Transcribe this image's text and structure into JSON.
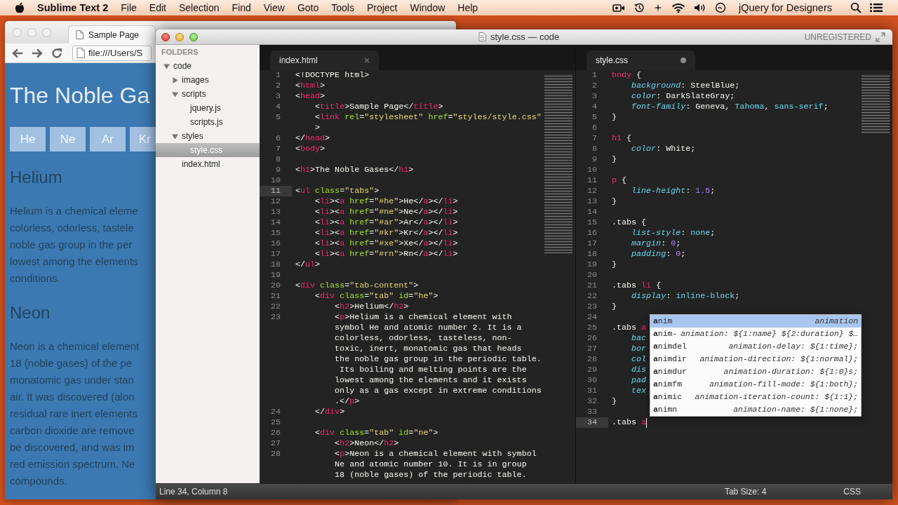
{
  "menubar": {
    "app": "Sublime Text 2",
    "menus": [
      "File",
      "Edit",
      "Selection",
      "Find",
      "View",
      "Goto",
      "Tools",
      "Project",
      "Window",
      "Help"
    ],
    "account": "jQuery for Designers"
  },
  "browser": {
    "tabs": [
      {
        "label": "Sample Page",
        "selected": true
      }
    ],
    "address": "file:///Users/S",
    "page": {
      "heading": "The Noble Ga",
      "tabs": [
        "He",
        "Ne",
        "Ar",
        "Kr"
      ],
      "sections": [
        {
          "heading": "Helium",
          "lines": [
            "Helium is a chemical eleme",
            "colorless, odorless, tastele",
            "noble gas group in the per",
            "lowest among the elements",
            "conditions."
          ]
        },
        {
          "heading": "Neon",
          "lines": [
            "Neon is a chemical element",
            "18 (noble gases) of the pe",
            "monatomic gas under stan",
            "air. It was discovered (alon",
            "residual rare inert elements",
            "carbon dioxide are remove",
            "be discovered, and was im",
            "red emission spectrum. Ne",
            "compounds."
          ]
        }
      ]
    }
  },
  "editor": {
    "title": "style.css — code",
    "registration": "UNREGISTERED",
    "sidebar": {
      "header": "FOLDERS",
      "items": [
        {
          "label": "code",
          "kind": "folder",
          "expanded": true,
          "selected": false,
          "children": [
            {
              "label": "images",
              "kind": "folder",
              "expanded": false,
              "selected": false
            },
            {
              "label": "scripts",
              "kind": "folder",
              "expanded": true,
              "selected": false,
              "children": [
                {
                  "label": "jquery.js",
                  "kind": "file",
                  "selected": false
                },
                {
                  "label": "scripts.js",
                  "kind": "file",
                  "selected": false
                }
              ]
            },
            {
              "label": "styles",
              "kind": "folder",
              "expanded": true,
              "selected": false,
              "children": [
                {
                  "label": "style.css",
                  "kind": "file",
                  "selected": true
                }
              ]
            },
            {
              "label": "index.html",
              "kind": "file",
              "selected": false
            }
          ]
        }
      ]
    },
    "groups": [
      {
        "focused": false,
        "tab": {
          "label": "index.html",
          "dirty": false
        },
        "rows": [
          {
            "n": "1",
            "current": false,
            "tokens": [
              {
                "kind": "pl",
                "text": "<!DOCTYPE html>"
              }
            ]
          },
          {
            "n": "2",
            "current": false,
            "tokens": [
              {
                "kind": "pl",
                "text": "<"
              },
              {
                "kind": "tag",
                "text": "html"
              },
              {
                "kind": "pl",
                "text": ">"
              }
            ]
          },
          {
            "n": "3",
            "current": false,
            "tokens": [
              {
                "kind": "pl",
                "text": "<"
              },
              {
                "kind": "tag",
                "text": "head"
              },
              {
                "kind": "pl",
                "text": ">"
              }
            ]
          },
          {
            "n": "4",
            "current": false,
            "tokens": [
              {
                "kind": "pl",
                "text": "    <"
              },
              {
                "kind": "tag",
                "text": "title"
              },
              {
                "kind": "pl",
                "text": ">Sample Page</"
              },
              {
                "kind": "tag",
                "text": "title"
              },
              {
                "kind": "pl",
                "text": ">"
              }
            ]
          },
          {
            "n": "5",
            "current": false,
            "tokens": [
              {
                "kind": "pl",
                "text": "    <"
              },
              {
                "kind": "tag",
                "text": "link"
              },
              {
                "kind": "attr",
                "text": " rel"
              },
              {
                "kind": "pl",
                "text": "="
              },
              {
                "kind": "str",
                "text": "\"stylesheet\""
              },
              {
                "kind": "attr",
                "text": " href"
              },
              {
                "kind": "pl",
                "text": "="
              },
              {
                "kind": "str",
                "text": "\"styles/style.css\""
              }
            ]
          },
          {
            "current": false,
            "tokens": [
              {
                "kind": "pl",
                "text": "    >"
              }
            ]
          },
          {
            "n": "6",
            "current": false,
            "tokens": [
              {
                "kind": "pl",
                "text": "</"
              },
              {
                "kind": "tag",
                "text": "head"
              },
              {
                "kind": "pl",
                "text": ">"
              }
            ]
          },
          {
            "n": "7",
            "current": false,
            "tokens": [
              {
                "kind": "pl",
                "text": "<"
              },
              {
                "kind": "tag",
                "text": "body"
              },
              {
                "kind": "pl",
                "text": ">"
              }
            ]
          },
          {
            "n": "8",
            "current": false
          },
          {
            "n": "9",
            "current": false,
            "tokens": [
              {
                "kind": "pl",
                "text": "<"
              },
              {
                "kind": "tag",
                "text": "h1"
              },
              {
                "kind": "pl",
                "text": ">The Noble Gases</"
              },
              {
                "kind": "tag",
                "text": "h1"
              },
              {
                "kind": "pl",
                "text": ">"
              }
            ]
          },
          {
            "n": "10",
            "current": false
          },
          {
            "n": "11",
            "current": true,
            "tokens": [
              {
                "kind": "pl",
                "text": "<"
              },
              {
                "kind": "tag",
                "text": "ul"
              },
              {
                "kind": "attr",
                "text": " class"
              },
              {
                "kind": "pl",
                "text": "="
              },
              {
                "kind": "str",
                "text": "\"tabs\""
              },
              {
                "kind": "pl",
                "text": ">"
              }
            ]
          },
          {
            "n": "12",
            "current": false,
            "tokens": [
              {
                "kind": "pl",
                "text": "    <"
              },
              {
                "kind": "tag",
                "text": "li"
              },
              {
                "kind": "pl",
                "text": "><"
              },
              {
                "kind": "tag",
                "text": "a"
              },
              {
                "kind": "attr",
                "text": " href"
              },
              {
                "kind": "pl",
                "text": "="
              },
              {
                "kind": "str",
                "text": "\"#he\""
              },
              {
                "kind": "pl",
                "text": ">He</"
              },
              {
                "kind": "tag",
                "text": "a"
              },
              {
                "kind": "pl",
                "text": "></"
              },
              {
                "kind": "tag",
                "text": "li"
              },
              {
                "kind": "pl",
                "text": ">"
              }
            ]
          },
          {
            "n": "13",
            "current": false,
            "tokens": [
              {
                "kind": "pl",
                "text": "    <"
              },
              {
                "kind": "tag",
                "text": "li"
              },
              {
                "kind": "pl",
                "text": "><"
              },
              {
                "kind": "tag",
                "text": "a"
              },
              {
                "kind": "attr",
                "text": " href"
              },
              {
                "kind": "pl",
                "text": "="
              },
              {
                "kind": "str",
                "text": "\"#ne\""
              },
              {
                "kind": "pl",
                "text": ">Ne</"
              },
              {
                "kind": "tag",
                "text": "a"
              },
              {
                "kind": "pl",
                "text": "></"
              },
              {
                "kind": "tag",
                "text": "li"
              },
              {
                "kind": "pl",
                "text": ">"
              }
            ]
          },
          {
            "n": "14",
            "current": false,
            "tokens": [
              {
                "kind": "pl",
                "text": "    <"
              },
              {
                "kind": "tag",
                "text": "li"
              },
              {
                "kind": "pl",
                "text": "><"
              },
              {
                "kind": "tag",
                "text": "a"
              },
              {
                "kind": "attr",
                "text": " href"
              },
              {
                "kind": "pl",
                "text": "="
              },
              {
                "kind": "str",
                "text": "\"#ar\""
              },
              {
                "kind": "pl",
                "text": ">Ar</"
              },
              {
                "kind": "tag",
                "text": "a"
              },
              {
                "kind": "pl",
                "text": "></"
              },
              {
                "kind": "tag",
                "text": "li"
              },
              {
                "kind": "pl",
                "text": ">"
              }
            ]
          },
          {
            "n": "15",
            "current": false,
            "tokens": [
              {
                "kind": "pl",
                "text": "    <"
              },
              {
                "kind": "tag",
                "text": "li"
              },
              {
                "kind": "pl",
                "text": "><"
              },
              {
                "kind": "tag",
                "text": "a"
              },
              {
                "kind": "attr",
                "text": " href"
              },
              {
                "kind": "pl",
                "text": "="
              },
              {
                "kind": "str",
                "text": "\"#kr\""
              },
              {
                "kind": "pl",
                "text": ">Kr</"
              },
              {
                "kind": "tag",
                "text": "a"
              },
              {
                "kind": "pl",
                "text": "></"
              },
              {
                "kind": "tag",
                "text": "li"
              },
              {
                "kind": "pl",
                "text": ">"
              }
            ]
          },
          {
            "n": "16",
            "current": false,
            "tokens": [
              {
                "kind": "pl",
                "text": "    <"
              },
              {
                "kind": "tag",
                "text": "li"
              },
              {
                "kind": "pl",
                "text": "><"
              },
              {
                "kind": "tag",
                "text": "a"
              },
              {
                "kind": "attr",
                "text": " href"
              },
              {
                "kind": "pl",
                "text": "="
              },
              {
                "kind": "str",
                "text": "\"#xe\""
              },
              {
                "kind": "pl",
                "text": ">Xe</"
              },
              {
                "kind": "tag",
                "text": "a"
              },
              {
                "kind": "pl",
                "text": "></"
              },
              {
                "kind": "tag",
                "text": "li"
              },
              {
                "kind": "pl",
                "text": ">"
              }
            ]
          },
          {
            "n": "17",
            "current": false,
            "tokens": [
              {
                "kind": "pl",
                "text": "    <"
              },
              {
                "kind": "tag",
                "text": "li"
              },
              {
                "kind": "pl",
                "text": "><"
              },
              {
                "kind": "tag",
                "text": "a"
              },
              {
                "kind": "attr",
                "text": " href"
              },
              {
                "kind": "pl",
                "text": "="
              },
              {
                "kind": "str",
                "text": "\"#rn\""
              },
              {
                "kind": "pl",
                "text": ">Rn</"
              },
              {
                "kind": "tag",
                "text": "a"
              },
              {
                "kind": "pl",
                "text": "></"
              },
              {
                "kind": "tag",
                "text": "li"
              },
              {
                "kind": "pl",
                "text": ">"
              }
            ]
          },
          {
            "n": "18",
            "current": false,
            "tokens": [
              {
                "kind": "pl",
                "text": "</"
              },
              {
                "kind": "tag",
                "text": "ul"
              },
              {
                "kind": "pl",
                "text": ">"
              }
            ]
          },
          {
            "n": "19",
            "current": false
          },
          {
            "n": "20",
            "current": false,
            "tokens": [
              {
                "kind": "pl",
                "text": "<"
              },
              {
                "kind": "tag",
                "text": "div"
              },
              {
                "kind": "attr",
                "text": " class"
              },
              {
                "kind": "pl",
                "text": "="
              },
              {
                "kind": "str",
                "text": "\"tab-content\""
              },
              {
                "kind": "pl",
                "text": ">"
              }
            ]
          },
          {
            "n": "21",
            "current": false,
            "tokens": [
              {
                "kind": "pl",
                "text": "    <"
              },
              {
                "kind": "tag",
                "text": "div"
              },
              {
                "kind": "attr",
                "text": " class"
              },
              {
                "kind": "pl",
                "text": "="
              },
              {
                "kind": "str",
                "text": "\"tab\""
              },
              {
                "kind": "attr",
                "text": " id"
              },
              {
                "kind": "pl",
                "text": "="
              },
              {
                "kind": "str",
                "text": "\"he\""
              },
              {
                "kind": "pl",
                "text": ">"
              }
            ]
          },
          {
            "n": "22",
            "current": false,
            "tokens": [
              {
                "kind": "pl",
                "text": "        <"
              },
              {
                "kind": "tag",
                "text": "h2"
              },
              {
                "kind": "pl",
                "text": ">Helium</"
              },
              {
                "kind": "tag",
                "text": "h2"
              },
              {
                "kind": "pl",
                "text": ">"
              }
            ]
          },
          {
            "n": "23",
            "current": false,
            "tokens": [
              {
                "kind": "pl",
                "text": "        <"
              },
              {
                "kind": "tag",
                "text": "p"
              },
              {
                "kind": "pl",
                "text": ">Helium is a chemical element with"
              }
            ]
          },
          {
            "current": false,
            "tokens": [
              {
                "kind": "pl",
                "text": "        symbol He and atomic number 2. It is a"
              }
            ]
          },
          {
            "current": false,
            "tokens": [
              {
                "kind": "pl",
                "text": "        colorless, odorless, tasteless, non-"
              }
            ]
          },
          {
            "current": false,
            "tokens": [
              {
                "kind": "pl",
                "text": "        toxic, inert, monatomic gas that heads"
              }
            ]
          },
          {
            "current": false,
            "tokens": [
              {
                "kind": "pl",
                "text": "        the noble gas group in the periodic table."
              }
            ]
          },
          {
            "current": false,
            "tokens": [
              {
                "kind": "pl",
                "text": "         Its boiling and melting points are the"
              }
            ]
          },
          {
            "current": false,
            "tokens": [
              {
                "kind": "pl",
                "text": "        lowest among the elements and it exists"
              }
            ]
          },
          {
            "current": false,
            "tokens": [
              {
                "kind": "pl",
                "text": "        only as a gas except in extreme conditions"
              }
            ]
          },
          {
            "current": false,
            "tokens": [
              {
                "kind": "pl",
                "text": "        .</"
              },
              {
                "kind": "tag",
                "text": "p"
              },
              {
                "kind": "pl",
                "text": ">"
              }
            ]
          },
          {
            "n": "24",
            "current": false,
            "tokens": [
              {
                "kind": "pl",
                "text": "    </"
              },
              {
                "kind": "tag",
                "text": "div"
              },
              {
                "kind": "pl",
                "text": ">"
              }
            ]
          },
          {
            "n": "25",
            "current": false
          },
          {
            "n": "26",
            "current": false,
            "tokens": [
              {
                "kind": "pl",
                "text": "    <"
              },
              {
                "kind": "tag",
                "text": "div"
              },
              {
                "kind": "attr",
                "text": " class"
              },
              {
                "kind": "pl",
                "text": "="
              },
              {
                "kind": "str",
                "text": "\"tab\""
              },
              {
                "kind": "attr",
                "text": " id"
              },
              {
                "kind": "pl",
                "text": "="
              },
              {
                "kind": "str",
                "text": "\"ne\""
              },
              {
                "kind": "pl",
                "text": ">"
              }
            ]
          },
          {
            "n": "27",
            "current": false,
            "tokens": [
              {
                "kind": "pl",
                "text": "        <"
              },
              {
                "kind": "tag",
                "text": "h2"
              },
              {
                "kind": "pl",
                "text": ">Neon</"
              },
              {
                "kind": "tag",
                "text": "h2"
              },
              {
                "kind": "pl",
                "text": ">"
              }
            ]
          },
          {
            "n": "28",
            "current": false,
            "tokens": [
              {
                "kind": "pl",
                "text": "        <"
              },
              {
                "kind": "tag",
                "text": "p"
              },
              {
                "kind": "pl",
                "text": ">Neon is a chemical element with symbol"
              }
            ]
          },
          {
            "current": false,
            "tokens": [
              {
                "kind": "pl",
                "text": "        Ne and atomic number 10. It is in group"
              }
            ]
          },
          {
            "current": false,
            "tokens": [
              {
                "kind": "pl",
                "text": "        18 (noble gases) of the periodic table."
              }
            ]
          }
        ]
      },
      {
        "focused": true,
        "tab": {
          "label": "style.css",
          "dirty": true
        },
        "rows": [
          {
            "n": "1",
            "current": false,
            "tokens": [
              {
                "kind": "sel",
                "text": "body"
              },
              {
                "kind": "pl",
                "text": " {"
              }
            ]
          },
          {
            "n": "2",
            "current": false,
            "tokens": [
              {
                "kind": "prop",
                "text": "    background"
              },
              {
                "kind": "pl",
                "text": ": SteelBlue;"
              }
            ]
          },
          {
            "n": "3",
            "current": false,
            "tokens": [
              {
                "kind": "prop",
                "text": "    color"
              },
              {
                "kind": "pl",
                "text": ": DarkSlateGray;"
              }
            ]
          },
          {
            "n": "4",
            "current": false,
            "tokens": [
              {
                "kind": "prop",
                "text": "    font-family"
              },
              {
                "kind": "pl",
                "text": ": Geneva, "
              },
              {
                "kind": "kw",
                "text": "Tahoma"
              },
              {
                "kind": "pl",
                "text": ", "
              },
              {
                "kind": "kw",
                "text": "sans-serif"
              },
              {
                "kind": "pl",
                "text": ";"
              }
            ]
          },
          {
            "n": "5",
            "current": false,
            "tokens": [
              {
                "kind": "pl",
                "text": "}"
              }
            ]
          },
          {
            "n": "6",
            "current": false
          },
          {
            "n": "7",
            "current": false,
            "tokens": [
              {
                "kind": "sel",
                "text": "h1"
              },
              {
                "kind": "pl",
                "text": " {"
              }
            ]
          },
          {
            "n": "8",
            "current": false,
            "tokens": [
              {
                "kind": "prop",
                "text": "    color"
              },
              {
                "kind": "pl",
                "text": ": White;"
              }
            ]
          },
          {
            "n": "9",
            "current": false,
            "tokens": [
              {
                "kind": "pl",
                "text": "}"
              }
            ]
          },
          {
            "n": "10",
            "current": false
          },
          {
            "n": "11",
            "current": false,
            "tokens": [
              {
                "kind": "sel",
                "text": "p"
              },
              {
                "kind": "pl",
                "text": " {"
              }
            ]
          },
          {
            "n": "12",
            "current": false,
            "tokens": [
              {
                "kind": "prop",
                "text": "    line-height"
              },
              {
                "kind": "pl",
                "text": ": "
              },
              {
                "kind": "num",
                "text": "1.5"
              },
              {
                "kind": "pl",
                "text": ";"
              }
            ]
          },
          {
            "n": "13",
            "current": false,
            "tokens": [
              {
                "kind": "pl",
                "text": "}"
              }
            ]
          },
          {
            "n": "14",
            "current": false
          },
          {
            "n": "15",
            "current": false,
            "tokens": [
              {
                "kind": "pl",
                "text": ".tabs {"
              }
            ]
          },
          {
            "n": "16",
            "current": false,
            "tokens": [
              {
                "kind": "prop",
                "text": "    list-style"
              },
              {
                "kind": "pl",
                "text": ": "
              },
              {
                "kind": "kw",
                "text": "none"
              },
              {
                "kind": "pl",
                "text": ";"
              }
            ]
          },
          {
            "n": "17",
            "current": false,
            "tokens": [
              {
                "kind": "prop",
                "text": "    margin"
              },
              {
                "kind": "pl",
                "text": ": "
              },
              {
                "kind": "num",
                "text": "0"
              },
              {
                "kind": "pl",
                "text": ";"
              }
            ]
          },
          {
            "n": "18",
            "current": false,
            "tokens": [
              {
                "kind": "prop",
                "text": "    padding"
              },
              {
                "kind": "pl",
                "text": ": "
              },
              {
                "kind": "num",
                "text": "0"
              },
              {
                "kind": "pl",
                "text": ";"
              }
            ]
          },
          {
            "n": "19",
            "current": false,
            "tokens": [
              {
                "kind": "pl",
                "text": "}"
              }
            ]
          },
          {
            "n": "20",
            "current": false
          },
          {
            "n": "21",
            "current": false,
            "tokens": [
              {
                "kind": "pl",
                "text": ".tabs "
              },
              {
                "kind": "sel",
                "text": "li"
              },
              {
                "kind": "pl",
                "text": " {"
              }
            ]
          },
          {
            "n": "22",
            "current": false,
            "tokens": [
              {
                "kind": "prop",
                "text": "    display"
              },
              {
                "kind": "pl",
                "text": ": "
              },
              {
                "kind": "kw",
                "text": "inline-block"
              },
              {
                "kind": "pl",
                "text": ";"
              }
            ]
          },
          {
            "n": "23",
            "current": false,
            "tokens": [
              {
                "kind": "pl",
                "text": "}"
              }
            ]
          },
          {
            "n": "24",
            "current": false
          },
          {
            "n": "25",
            "current": false,
            "tokens": [
              {
                "kind": "pl",
                "text": ".tabs "
              },
              {
                "kind": "sel",
                "text": "a"
              }
            ]
          },
          {
            "n": "26",
            "current": false,
            "tokens": [
              {
                "kind": "prop",
                "text": "    bac"
              }
            ]
          },
          {
            "n": "27",
            "current": false,
            "tokens": [
              {
                "kind": "prop",
                "text": "    bor"
              }
            ]
          },
          {
            "n": "28",
            "current": false,
            "tokens": [
              {
                "kind": "prop",
                "text": "    col"
              }
            ]
          },
          {
            "n": "29",
            "current": false,
            "tokens": [
              {
                "kind": "prop",
                "text": "    dis"
              }
            ]
          },
          {
            "n": "30",
            "current": false,
            "tokens": [
              {
                "kind": "prop",
                "text": "    pad"
              }
            ]
          },
          {
            "n": "31",
            "current": false,
            "tokens": [
              {
                "kind": "prop",
                "text": "    tex"
              }
            ]
          },
          {
            "n": "32",
            "current": false,
            "tokens": [
              {
                "kind": "pl",
                "text": "}"
              }
            ]
          },
          {
            "n": "33",
            "current": false
          },
          {
            "n": "34",
            "current": true,
            "tokens": [
              {
                "kind": "pl",
                "text": ".tabs "
              },
              {
                "kind": "sel",
                "text": "a"
              }
            ]
          }
        ],
        "autocomplete": {
          "items": [
            {
              "trigger": "**a**nim",
              "completion": "animation",
              "selected": true
            },
            {
              "trigger": "**a**nim-",
              "completion": "animation: ${1:name} ${2:duration} $…",
              "selected": false
            },
            {
              "trigger": "**a**nimdel",
              "completion": "animation-delay: ${1:time};",
              "selected": false
            },
            {
              "trigger": "**a**nimdir",
              "completion": "animation-direction: ${1:normal};",
              "selected": false
            },
            {
              "trigger": "**a**nimdur",
              "completion": "animation-duration: ${1:0}s;",
              "selected": false
            },
            {
              "trigger": "**a**nimfm",
              "completion": "animation-fill-mode: ${1:both};",
              "selected": false
            },
            {
              "trigger": "**a**nimic",
              "completion": "animation-iteration-count: ${1:1};",
              "selected": false
            },
            {
              "trigger": "**a**nimn",
              "completion": "animation-name: ${1:none};",
              "selected": false
            }
          ]
        }
      }
    ],
    "status_bar": {
      "position": "Line 34, Column 8",
      "tab_size": "Tab Size: 4",
      "syntax": "CSS"
    }
  }
}
